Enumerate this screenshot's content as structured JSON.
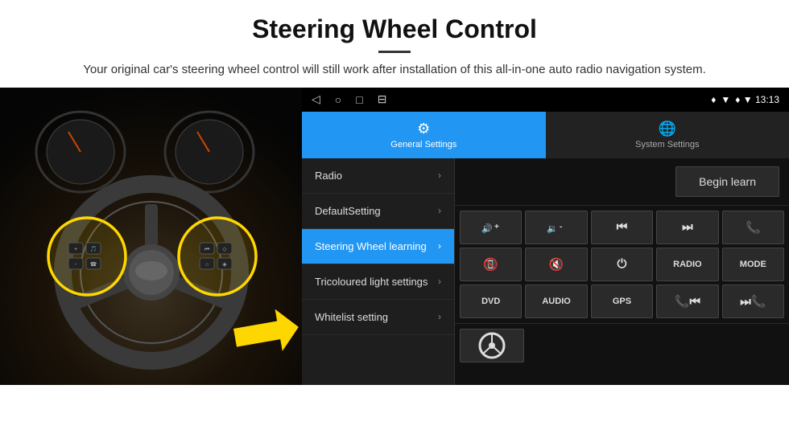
{
  "header": {
    "title": "Steering Wheel Control",
    "subtitle": "Your original car's steering wheel control will still work after installation of this all-in-one auto radio navigation system."
  },
  "statusBar": {
    "navIcons": [
      "◁",
      "○",
      "□",
      "⊟"
    ],
    "rightIcons": "♦ ▼ 13:13"
  },
  "tabs": [
    {
      "id": "general",
      "label": "General Settings",
      "icon": "⚙",
      "active": true
    },
    {
      "id": "system",
      "label": "System Settings",
      "icon": "🌐",
      "active": false
    }
  ],
  "menuItems": [
    {
      "id": "radio",
      "label": "Radio",
      "active": false
    },
    {
      "id": "default",
      "label": "DefaultSetting",
      "active": false
    },
    {
      "id": "steering",
      "label": "Steering Wheel learning",
      "active": true
    },
    {
      "id": "tricolour",
      "label": "Tricoloured light settings",
      "active": false
    },
    {
      "id": "whitelist",
      "label": "Whitelist setting",
      "active": false
    }
  ],
  "beginLearnBtn": "Begin learn",
  "controlButtons": [
    {
      "id": "vol-up",
      "icon": "🔊+",
      "symbol": "▲+"
    },
    {
      "id": "vol-down",
      "icon": "🔉-",
      "symbol": "▼-"
    },
    {
      "id": "prev-track",
      "icon": "|◄◄"
    },
    {
      "id": "next-track",
      "icon": "▶▶|"
    },
    {
      "id": "phone",
      "icon": "☎"
    },
    {
      "id": "hang-up",
      "icon": "☎"
    },
    {
      "id": "mute",
      "icon": "🔇"
    },
    {
      "id": "power",
      "icon": "⏻"
    },
    {
      "id": "radio-btn",
      "label": "RADIO"
    },
    {
      "id": "mode-btn",
      "label": "MODE"
    },
    {
      "id": "dvd-btn",
      "label": "DVD"
    },
    {
      "id": "audio-btn",
      "label": "AUDIO"
    },
    {
      "id": "gps-btn",
      "label": "GPS"
    },
    {
      "id": "tel-prev",
      "icon": "☎◄◄"
    },
    {
      "id": "tel-next",
      "icon": "▶▶☎"
    }
  ],
  "bottomIcon": "🚗"
}
